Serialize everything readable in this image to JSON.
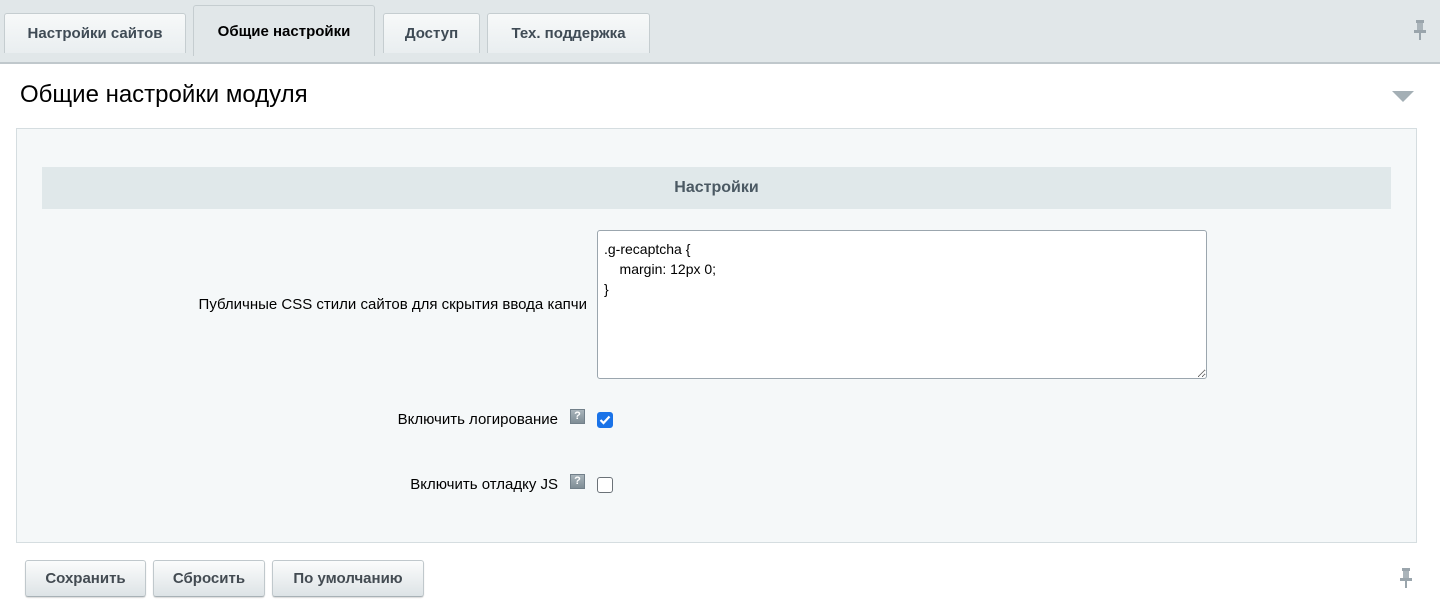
{
  "tabs": [
    {
      "label": "Настройки сайтов",
      "active": false
    },
    {
      "label": "Общие настройки",
      "active": true
    },
    {
      "label": "Доступ",
      "active": false
    },
    {
      "label": "Тех. поддержка",
      "active": false
    }
  ],
  "panel": {
    "title": "Общие настройки модуля",
    "section_header": "Настройки"
  },
  "fields": {
    "css": {
      "label": "Публичные CSS стили сайтов для скрытия ввода капчи",
      "value": ".g-recaptcha {\n    margin: 12px 0;\n}"
    },
    "logging": {
      "label": "Включить логирование",
      "checked": true,
      "help_icon": "help-icon"
    },
    "js_debug": {
      "label": "Включить отладку JS",
      "checked": false,
      "help_icon": "help-icon"
    }
  },
  "buttons": {
    "save": "Сохранить",
    "reset": "Сбросить",
    "default": "По умолчанию"
  },
  "icons": {
    "pin": "pin-icon",
    "collapse": "collapse-arrow-icon",
    "checkmark": "checkmark-icon"
  },
  "colors": {
    "accent_checkbox": "#1a73e8",
    "tab_bar": "#e1e7e9",
    "section_header": "#e0e8ea"
  }
}
